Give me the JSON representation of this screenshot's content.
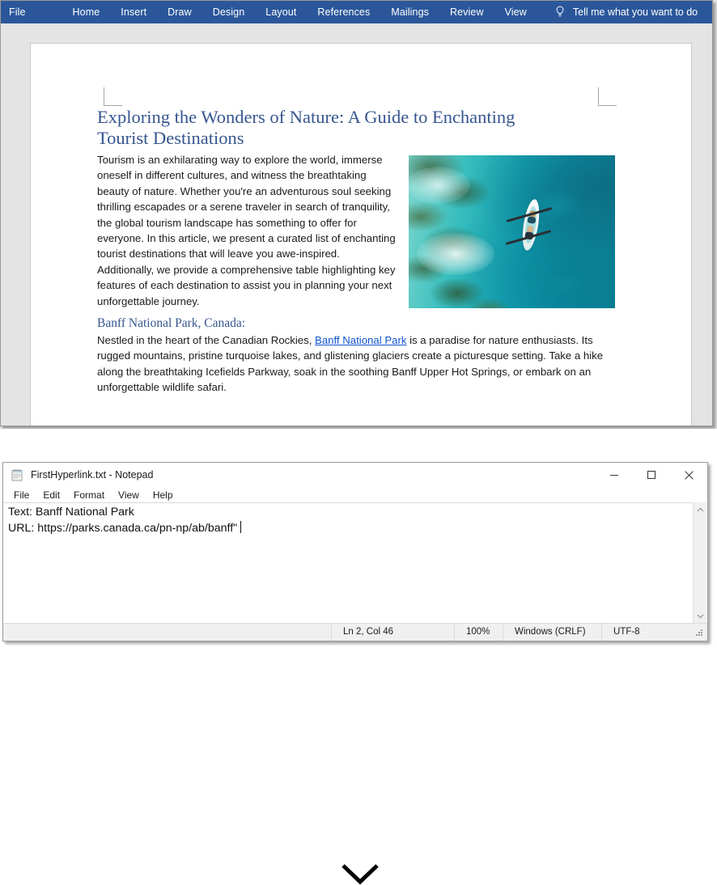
{
  "word": {
    "ribbon": {
      "tabs": [
        {
          "id": "file",
          "label": "File"
        },
        {
          "id": "home",
          "label": "Home"
        },
        {
          "id": "insert",
          "label": "Insert"
        },
        {
          "id": "draw",
          "label": "Draw"
        },
        {
          "id": "design",
          "label": "Design"
        },
        {
          "id": "layout",
          "label": "Layout"
        },
        {
          "id": "references",
          "label": "References"
        },
        {
          "id": "mailings",
          "label": "Mailings"
        },
        {
          "id": "review",
          "label": "Review"
        },
        {
          "id": "view",
          "label": "View"
        }
      ],
      "tell_me": "Tell me what you want to do",
      "tell_me_icon": "lightbulb-icon",
      "background_color": "#2b579a",
      "text_color": "#ffffff"
    },
    "document": {
      "title": "Exploring the Wonders of Nature: A Guide to Enchanting Tourist Destinations",
      "title_color": "#36558f",
      "intro_paragraph": "Tourism is an exhilarating way to explore the world, immerse oneself in different cultures, and witness the breathtaking beauty of nature. Whether you're an adventurous soul seeking thrilling escapades or a serene traveler in search of tranquility, the global tourism landscape has something to offer for everyone. In this article, we present a curated list of enchanting tourist destinations that will leave you awe-inspired. Additionally, we provide a comprehensive table highlighting key features of each destination to assist you in planning your next unforgettable journey.",
      "image": {
        "name": "kayak-aerial-photo",
        "alt": "Aerial view of a kayak on turquoise water over a coral reef"
      },
      "section": {
        "heading": "Banff National Park, Canada:",
        "heading_color": "#36558f",
        "text_before_link": "Nestled in the heart of the Canadian Rockies, ",
        "link_text": "Banff National Park",
        "link_color": "#1155cc",
        "text_after_link": " is a paradise for nature enthusiasts. Its rugged mountains, pristine turquoise lakes, and glistening glaciers create a picturesque setting. Take a hike along the breathtaking Icefields Parkway, soak in the soothing Banff Upper Hot Springs, or embark on an unforgettable wildlife safari."
      }
    }
  },
  "separator": {
    "icon": "chevron-down-icon"
  },
  "notepad": {
    "title": "FirstHyperlink.txt - Notepad",
    "app_icon": "notepad-icon",
    "window_buttons": [
      {
        "id": "minimize",
        "icon": "minimize-icon"
      },
      {
        "id": "maximize",
        "icon": "maximize-icon"
      },
      {
        "id": "close",
        "icon": "close-icon"
      }
    ],
    "menu": [
      {
        "id": "file",
        "label": "File"
      },
      {
        "id": "edit",
        "label": "Edit"
      },
      {
        "id": "format",
        "label": "Format"
      },
      {
        "id": "view",
        "label": "View"
      },
      {
        "id": "help",
        "label": "Help"
      }
    ],
    "editor": {
      "line1": "Text: Banff National Park",
      "line2": "URL: https://parks.canada.ca/pn-np/ab/banff\""
    },
    "scrollbar": {
      "up_icon": "chevron-up-icon",
      "down_icon": "chevron-down-icon"
    },
    "status": {
      "position": "Ln 2, Col 46",
      "zoom": "100%",
      "line_ending": "Windows (CRLF)",
      "encoding": "UTF-8"
    }
  }
}
